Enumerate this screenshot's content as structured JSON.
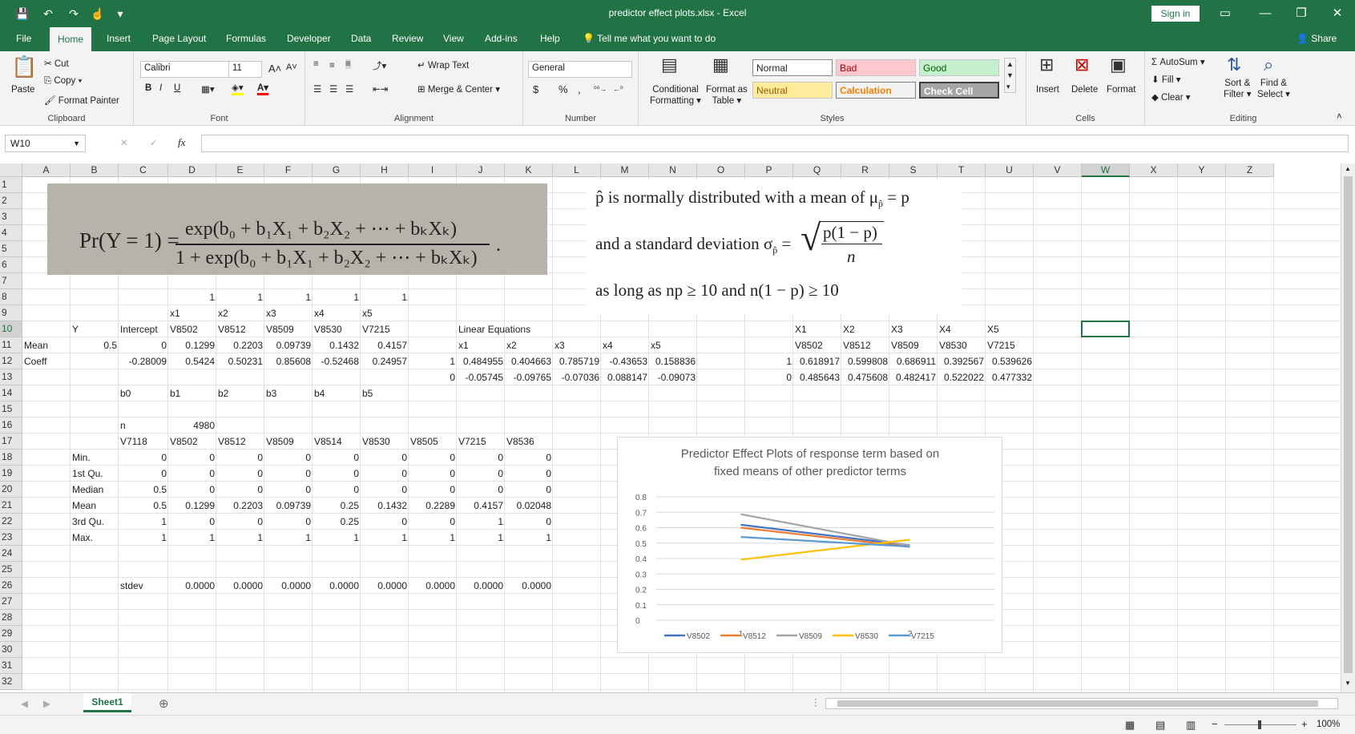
{
  "window": {
    "title": "predictor effect plots.xlsx  -  Excel",
    "sign_in": "Sign in",
    "minimize": "—",
    "restore": "❐",
    "close": "✕"
  },
  "qat": {
    "save": "💾",
    "undo": "↶",
    "redo": "↷",
    "touch": "☝",
    "more": "▾"
  },
  "tabs": [
    "File",
    "Home",
    "Insert",
    "Page Layout",
    "Formulas",
    "Developer",
    "Data",
    "Review",
    "View",
    "Add-ins",
    "Help"
  ],
  "tell_me": "Tell me what you want to do",
  "share": "Share",
  "ribbon": {
    "clipboard": {
      "label": "Clipboard",
      "paste": "Paste",
      "cut": "Cut",
      "copy": "Copy",
      "format_painter": "Format Painter"
    },
    "font": {
      "label": "Font",
      "name": "Calibri",
      "size": "11",
      "bold": "B",
      "italic": "I",
      "underline": "U"
    },
    "alignment": {
      "label": "Alignment",
      "wrap_text": "Wrap Text",
      "merge_center": "Merge & Center"
    },
    "number": {
      "label": "Number",
      "format": "General",
      "currency": "$",
      "percent": "%",
      "comma": ","
    },
    "styles": {
      "label": "Styles",
      "conditional": "Conditional",
      "conditional2": "Formatting",
      "format_as": "Format as",
      "format_as2": "Table",
      "normal": "Normal",
      "bad": "Bad",
      "good": "Good",
      "neutral": "Neutral",
      "calculation": "Calculation",
      "check_cell": "Check Cell"
    },
    "cells": {
      "label": "Cells",
      "insert": "Insert",
      "delete": "Delete",
      "format": "Format"
    },
    "editing": {
      "label": "Editing",
      "autosum": "AutoSum",
      "fill": "Fill",
      "clear": "Clear",
      "sort": "Sort &",
      "sort2": "Filter",
      "find": "Find &",
      "find2": "Select"
    }
  },
  "formula_bar": {
    "name_box": "W10",
    "fx": "fx",
    "cancel": "✕",
    "enter": "✓",
    "value": ""
  },
  "columns": [
    "A",
    "B",
    "C",
    "D",
    "E",
    "F",
    "G",
    "H",
    "I",
    "J",
    "K",
    "L",
    "M",
    "N",
    "O",
    "P",
    "Q",
    "R",
    "S",
    "T",
    "U",
    "V",
    "W",
    "X",
    "Y",
    "Z"
  ],
  "rows": [
    "1",
    "2",
    "3",
    "4",
    "5",
    "6",
    "7",
    "8",
    "9",
    "10",
    "11",
    "12",
    "13",
    "14",
    "15",
    "16",
    "17",
    "18",
    "19",
    "20",
    "21",
    "22",
    "23",
    "24",
    "25",
    "26",
    "27",
    "28",
    "29",
    "30",
    "31",
    "32"
  ],
  "cells": [
    {
      "c": "D",
      "r": 8,
      "v": "1",
      "a": "r"
    },
    {
      "c": "E",
      "r": 8,
      "v": "1",
      "a": "r"
    },
    {
      "c": "F",
      "r": 8,
      "v": "1",
      "a": "r"
    },
    {
      "c": "G",
      "r": 8,
      "v": "1",
      "a": "r"
    },
    {
      "c": "H",
      "r": 8,
      "v": "1",
      "a": "r"
    },
    {
      "c": "D",
      "r": 9,
      "v": "x1"
    },
    {
      "c": "E",
      "r": 9,
      "v": "x2"
    },
    {
      "c": "F",
      "r": 9,
      "v": "x3"
    },
    {
      "c": "G",
      "r": 9,
      "v": "x4"
    },
    {
      "c": "H",
      "r": 9,
      "v": "x5"
    },
    {
      "c": "B",
      "r": 10,
      "v": "Y"
    },
    {
      "c": "C",
      "r": 10,
      "v": "Intercept"
    },
    {
      "c": "D",
      "r": 10,
      "v": "V8502"
    },
    {
      "c": "E",
      "r": 10,
      "v": "V8512"
    },
    {
      "c": "F",
      "r": 10,
      "v": "V8509"
    },
    {
      "c": "G",
      "r": 10,
      "v": "V8530"
    },
    {
      "c": "H",
      "r": 10,
      "v": "V7215"
    },
    {
      "c": "J",
      "r": 10,
      "v": "Linear Equations"
    },
    {
      "c": "Q",
      "r": 10,
      "v": "X1"
    },
    {
      "c": "R",
      "r": 10,
      "v": "X2"
    },
    {
      "c": "S",
      "r": 10,
      "v": "X3"
    },
    {
      "c": "T",
      "r": 10,
      "v": "X4"
    },
    {
      "c": "U",
      "r": 10,
      "v": "X5"
    },
    {
      "c": "A",
      "r": 11,
      "v": "Mean"
    },
    {
      "c": "B",
      "r": 11,
      "v": "0.5",
      "a": "r"
    },
    {
      "c": "C",
      "r": 11,
      "v": "0",
      "a": "r"
    },
    {
      "c": "D",
      "r": 11,
      "v": "0.1299",
      "a": "r"
    },
    {
      "c": "E",
      "r": 11,
      "v": "0.2203",
      "a": "r"
    },
    {
      "c": "F",
      "r": 11,
      "v": "0.09739",
      "a": "r"
    },
    {
      "c": "G",
      "r": 11,
      "v": "0.1432",
      "a": "r"
    },
    {
      "c": "H",
      "r": 11,
      "v": "0.4157",
      "a": "r"
    },
    {
      "c": "J",
      "r": 11,
      "v": "x1"
    },
    {
      "c": "K",
      "r": 11,
      "v": "x2"
    },
    {
      "c": "L",
      "r": 11,
      "v": "x3"
    },
    {
      "c": "M",
      "r": 11,
      "v": "x4"
    },
    {
      "c": "N",
      "r": 11,
      "v": "x5"
    },
    {
      "c": "Q",
      "r": 11,
      "v": "V8502"
    },
    {
      "c": "R",
      "r": 11,
      "v": "V8512"
    },
    {
      "c": "S",
      "r": 11,
      "v": "V8509"
    },
    {
      "c": "T",
      "r": 11,
      "v": "V8530"
    },
    {
      "c": "U",
      "r": 11,
      "v": "V7215"
    },
    {
      "c": "A",
      "r": 12,
      "v": "Coeff"
    },
    {
      "c": "C",
      "r": 12,
      "v": "-0.28009",
      "a": "r"
    },
    {
      "c": "D",
      "r": 12,
      "v": "0.5424",
      "a": "r"
    },
    {
      "c": "E",
      "r": 12,
      "v": "0.50231",
      "a": "r"
    },
    {
      "c": "F",
      "r": 12,
      "v": "0.85608",
      "a": "r"
    },
    {
      "c": "G",
      "r": 12,
      "v": "-0.52468",
      "a": "r"
    },
    {
      "c": "H",
      "r": 12,
      "v": "0.24957",
      "a": "r"
    },
    {
      "c": "I",
      "r": 12,
      "v": "1",
      "a": "r"
    },
    {
      "c": "J",
      "r": 12,
      "v": "0.484955",
      "a": "r"
    },
    {
      "c": "K",
      "r": 12,
      "v": "0.404663",
      "a": "r"
    },
    {
      "c": "L",
      "r": 12,
      "v": "0.785719",
      "a": "r"
    },
    {
      "c": "M",
      "r": 12,
      "v": "-0.43653",
      "a": "r"
    },
    {
      "c": "N",
      "r": 12,
      "v": "0.158836",
      "a": "r"
    },
    {
      "c": "P",
      "r": 12,
      "v": "1",
      "a": "r"
    },
    {
      "c": "Q",
      "r": 12,
      "v": "0.618917",
      "a": "r"
    },
    {
      "c": "R",
      "r": 12,
      "v": "0.599808",
      "a": "r"
    },
    {
      "c": "S",
      "r": 12,
      "v": "0.686911",
      "a": "r"
    },
    {
      "c": "T",
      "r": 12,
      "v": "0.392567",
      "a": "r"
    },
    {
      "c": "U",
      "r": 12,
      "v": "0.539626",
      "a": "r"
    },
    {
      "c": "I",
      "r": 13,
      "v": "0",
      "a": "r"
    },
    {
      "c": "J",
      "r": 13,
      "v": "-0.05745",
      "a": "r"
    },
    {
      "c": "K",
      "r": 13,
      "v": "-0.09765",
      "a": "r"
    },
    {
      "c": "L",
      "r": 13,
      "v": "-0.07036",
      "a": "r"
    },
    {
      "c": "M",
      "r": 13,
      "v": "0.088147",
      "a": "r"
    },
    {
      "c": "N",
      "r": 13,
      "v": "-0.09073",
      "a": "r"
    },
    {
      "c": "P",
      "r": 13,
      "v": "0",
      "a": "r"
    },
    {
      "c": "Q",
      "r": 13,
      "v": "0.485643",
      "a": "r"
    },
    {
      "c": "R",
      "r": 13,
      "v": "0.475608",
      "a": "r"
    },
    {
      "c": "S",
      "r": 13,
      "v": "0.482417",
      "a": "r"
    },
    {
      "c": "T",
      "r": 13,
      "v": "0.522022",
      "a": "r"
    },
    {
      "c": "U",
      "r": 13,
      "v": "0.477332",
      "a": "r"
    },
    {
      "c": "C",
      "r": 14,
      "v": "b0"
    },
    {
      "c": "D",
      "r": 14,
      "v": "b1"
    },
    {
      "c": "E",
      "r": 14,
      "v": "b2"
    },
    {
      "c": "F",
      "r": 14,
      "v": "b3"
    },
    {
      "c": "G",
      "r": 14,
      "v": "b4"
    },
    {
      "c": "H",
      "r": 14,
      "v": "b5"
    },
    {
      "c": "C",
      "r": 16,
      "v": "n"
    },
    {
      "c": "D",
      "r": 16,
      "v": "4980",
      "a": "r"
    },
    {
      "c": "C",
      "r": 17,
      "v": "V7118"
    },
    {
      "c": "D",
      "r": 17,
      "v": "V8502"
    },
    {
      "c": "E",
      "r": 17,
      "v": "V8512"
    },
    {
      "c": "F",
      "r": 17,
      "v": "V8509"
    },
    {
      "c": "G",
      "r": 17,
      "v": "V8514"
    },
    {
      "c": "H",
      "r": 17,
      "v": "V8530"
    },
    {
      "c": "I",
      "r": 17,
      "v": "V8505"
    },
    {
      "c": "J",
      "r": 17,
      "v": "V7215"
    },
    {
      "c": "K",
      "r": 17,
      "v": "V8536"
    },
    {
      "c": "B",
      "r": 18,
      "v": "Min."
    },
    {
      "c": "C",
      "r": 18,
      "v": "0",
      "a": "r"
    },
    {
      "c": "D",
      "r": 18,
      "v": "0",
      "a": "r"
    },
    {
      "c": "E",
      "r": 18,
      "v": "0",
      "a": "r"
    },
    {
      "c": "F",
      "r": 18,
      "v": "0",
      "a": "r"
    },
    {
      "c": "G",
      "r": 18,
      "v": "0",
      "a": "r"
    },
    {
      "c": "H",
      "r": 18,
      "v": "0",
      "a": "r"
    },
    {
      "c": "I",
      "r": 18,
      "v": "0",
      "a": "r"
    },
    {
      "c": "J",
      "r": 18,
      "v": "0",
      "a": "r"
    },
    {
      "c": "K",
      "r": 18,
      "v": "0",
      "a": "r"
    },
    {
      "c": "B",
      "r": 19,
      "v": "1st Qu."
    },
    {
      "c": "C",
      "r": 19,
      "v": "0",
      "a": "r"
    },
    {
      "c": "D",
      "r": 19,
      "v": "0",
      "a": "r"
    },
    {
      "c": "E",
      "r": 19,
      "v": "0",
      "a": "r"
    },
    {
      "c": "F",
      "r": 19,
      "v": "0",
      "a": "r"
    },
    {
      "c": "G",
      "r": 19,
      "v": "0",
      "a": "r"
    },
    {
      "c": "H",
      "r": 19,
      "v": "0",
      "a": "r"
    },
    {
      "c": "I",
      "r": 19,
      "v": "0",
      "a": "r"
    },
    {
      "c": "J",
      "r": 19,
      "v": "0",
      "a": "r"
    },
    {
      "c": "K",
      "r": 19,
      "v": "0",
      "a": "r"
    },
    {
      "c": "B",
      "r": 20,
      "v": "Median"
    },
    {
      "c": "C",
      "r": 20,
      "v": "0.5",
      "a": "r"
    },
    {
      "c": "D",
      "r": 20,
      "v": "0",
      "a": "r"
    },
    {
      "c": "E",
      "r": 20,
      "v": "0",
      "a": "r"
    },
    {
      "c": "F",
      "r": 20,
      "v": "0",
      "a": "r"
    },
    {
      "c": "G",
      "r": 20,
      "v": "0",
      "a": "r"
    },
    {
      "c": "H",
      "r": 20,
      "v": "0",
      "a": "r"
    },
    {
      "c": "I",
      "r": 20,
      "v": "0",
      "a": "r"
    },
    {
      "c": "J",
      "r": 20,
      "v": "0",
      "a": "r"
    },
    {
      "c": "K",
      "r": 20,
      "v": "0",
      "a": "r"
    },
    {
      "c": "B",
      "r": 21,
      "v": "Mean"
    },
    {
      "c": "C",
      "r": 21,
      "v": "0.5",
      "a": "r"
    },
    {
      "c": "D",
      "r": 21,
      "v": "0.1299",
      "a": "r"
    },
    {
      "c": "E",
      "r": 21,
      "v": "0.2203",
      "a": "r"
    },
    {
      "c": "F",
      "r": 21,
      "v": "0.09739",
      "a": "r"
    },
    {
      "c": "G",
      "r": 21,
      "v": "0.25",
      "a": "r"
    },
    {
      "c": "H",
      "r": 21,
      "v": "0.1432",
      "a": "r"
    },
    {
      "c": "I",
      "r": 21,
      "v": "0.2289",
      "a": "r"
    },
    {
      "c": "J",
      "r": 21,
      "v": "0.4157",
      "a": "r"
    },
    {
      "c": "K",
      "r": 21,
      "v": "0.02048",
      "a": "r"
    },
    {
      "c": "B",
      "r": 22,
      "v": "3rd Qu."
    },
    {
      "c": "C",
      "r": 22,
      "v": "1",
      "a": "r"
    },
    {
      "c": "D",
      "r": 22,
      "v": "0",
      "a": "r"
    },
    {
      "c": "E",
      "r": 22,
      "v": "0",
      "a": "r"
    },
    {
      "c": "F",
      "r": 22,
      "v": "0",
      "a": "r"
    },
    {
      "c": "G",
      "r": 22,
      "v": "0.25",
      "a": "r"
    },
    {
      "c": "H",
      "r": 22,
      "v": "0",
      "a": "r"
    },
    {
      "c": "I",
      "r": 22,
      "v": "0",
      "a": "r"
    },
    {
      "c": "J",
      "r": 22,
      "v": "1",
      "a": "r"
    },
    {
      "c": "K",
      "r": 22,
      "v": "0",
      "a": "r"
    },
    {
      "c": "B",
      "r": 23,
      "v": "Max."
    },
    {
      "c": "C",
      "r": 23,
      "v": "1",
      "a": "r"
    },
    {
      "c": "D",
      "r": 23,
      "v": "1",
      "a": "r"
    },
    {
      "c": "E",
      "r": 23,
      "v": "1",
      "a": "r"
    },
    {
      "c": "F",
      "r": 23,
      "v": "1",
      "a": "r"
    },
    {
      "c": "G",
      "r": 23,
      "v": "1",
      "a": "r"
    },
    {
      "c": "H",
      "r": 23,
      "v": "1",
      "a": "r"
    },
    {
      "c": "I",
      "r": 23,
      "v": "1",
      "a": "r"
    },
    {
      "c": "J",
      "r": 23,
      "v": "1",
      "a": "r"
    },
    {
      "c": "K",
      "r": 23,
      "v": "1",
      "a": "r"
    },
    {
      "c": "C",
      "r": 26,
      "v": "stdev"
    },
    {
      "c": "D",
      "r": 26,
      "v": "0.0000",
      "a": "r"
    },
    {
      "c": "E",
      "r": 26,
      "v": "0.0000",
      "a": "r"
    },
    {
      "c": "F",
      "r": 26,
      "v": "0.0000",
      "a": "r"
    },
    {
      "c": "G",
      "r": 26,
      "v": "0.0000",
      "a": "r"
    },
    {
      "c": "H",
      "r": 26,
      "v": "0.0000",
      "a": "r"
    },
    {
      "c": "I",
      "r": 26,
      "v": "0.0000",
      "a": "r"
    },
    {
      "c": "J",
      "r": 26,
      "v": "0.0000",
      "a": "r"
    },
    {
      "c": "K",
      "r": 26,
      "v": "0.0000",
      "a": "r"
    }
  ],
  "selected_cell": "W10",
  "formula_image": {
    "lhs": "Pr(Y = 1) =",
    "numerator": "exp(b₀ + b₁X₁ + b₂X₂ + ⋯ + bₖXₖ)",
    "denominator": "1 + exp(b₀ + b₁X₁ + b₂X₂ + ⋯ + bₖXₖ)",
    "period": "."
  },
  "normal_text_image": {
    "line1": "p̂ is normally distributed with a mean of μ",
    "line1_sub": "p̂",
    "line1_end": " = p",
    "line2": "and a standard deviation σ",
    "line2_sub": "p̂",
    "line2_eq": " =",
    "sqrt_num": "p(1 − p)",
    "sqrt_den": "n",
    "line3": "as long as np ≥ 10 and n(1 − p) ≥ 10"
  },
  "chart_data": {
    "type": "line",
    "title": "Predictor Effect Plots of response term based on fixed means of other predictor terms",
    "categories": [
      "1",
      "2"
    ],
    "ylim": [
      0,
      0.8
    ],
    "yticks": [
      "0",
      "0.1",
      "0.2",
      "0.3",
      "0.4",
      "0.5",
      "0.6",
      "0.7",
      "0.8"
    ],
    "grid": true,
    "legend": "bottom",
    "series": [
      {
        "name": "V8502",
        "values": [
          0.618917,
          0.485643
        ],
        "color": "#4472c4"
      },
      {
        "name": "V8512",
        "values": [
          0.599808,
          0.475608
        ],
        "color": "#ed7d31"
      },
      {
        "name": "V8509",
        "values": [
          0.686911,
          0.482417
        ],
        "color": "#a5a5a5"
      },
      {
        "name": "V8530",
        "values": [
          0.392567,
          0.522022
        ],
        "color": "#ffc000"
      },
      {
        "name": "V7215",
        "values": [
          0.539626,
          0.477332
        ],
        "color": "#5b9bd5"
      }
    ]
  },
  "sheets": [
    "Sheet1"
  ],
  "status": {
    "zoom": "100%"
  },
  "colors": {
    "accent": "#217346"
  }
}
